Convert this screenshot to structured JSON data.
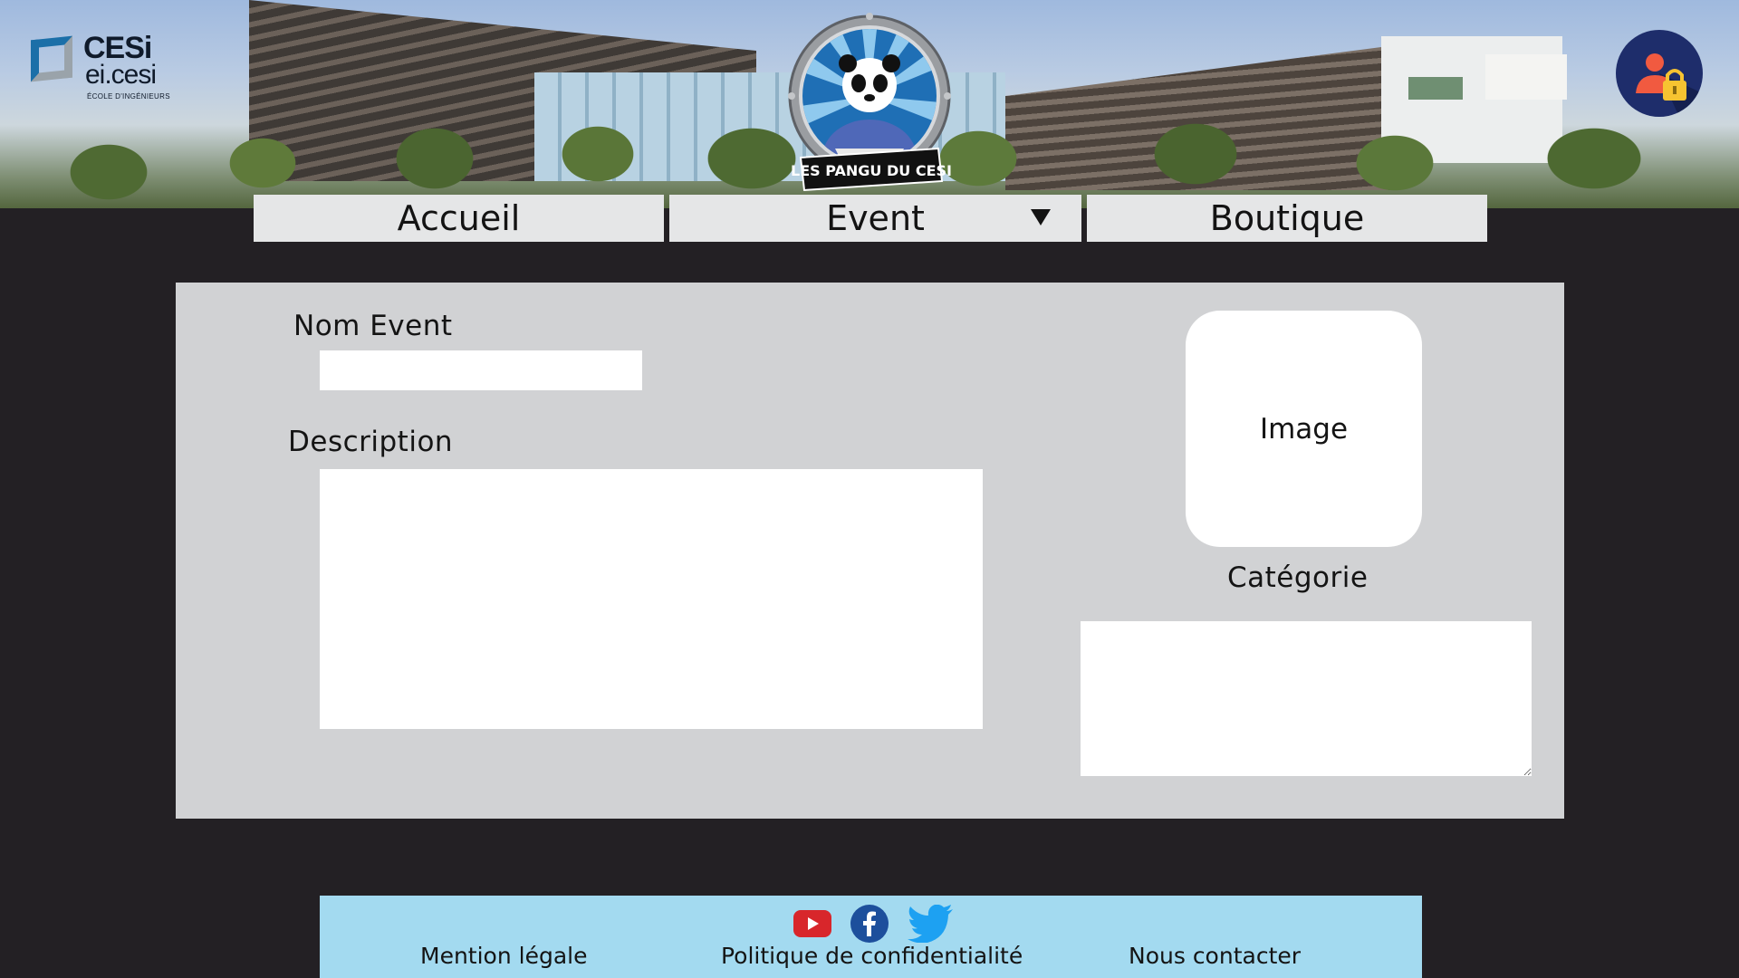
{
  "header": {
    "logo": {
      "line1": "CESi",
      "line2": "ei.cesi",
      "line3": "ÉCOLE D'INGÉNIEURS"
    },
    "mascot": {
      "banner_text": "LES PANGU DU CESI"
    },
    "account_icon": "user-lock-icon"
  },
  "nav": {
    "items": [
      {
        "label": "Accueil"
      },
      {
        "label": "Event",
        "has_dropdown": true
      },
      {
        "label": "Boutique"
      }
    ]
  },
  "form": {
    "name_label": "Nom Event",
    "name_value": "",
    "description_label": "Description",
    "description_value": "",
    "image_label": "Image",
    "category_label": "Catégorie",
    "category_value": ""
  },
  "footer": {
    "socials": [
      "youtube-icon",
      "facebook-icon",
      "twitter-icon"
    ],
    "links": [
      {
        "label": "Mention légale"
      },
      {
        "label": "Politique de confidentialité"
      },
      {
        "label": "Nous contacter"
      }
    ]
  },
  "colors": {
    "page_bg": "#232024",
    "nav_bg": "#e5e6e7",
    "panel_bg": "#d1d2d4",
    "footer_bg": "#a3daf0",
    "account_button": "#1e2d6b"
  }
}
